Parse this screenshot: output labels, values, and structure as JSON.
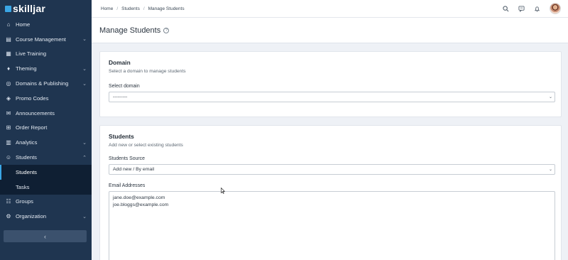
{
  "brand": {
    "name": "skilljar"
  },
  "sidebar": {
    "items": [
      {
        "label": "Home",
        "icon": "home-icon",
        "glyph": "⌂",
        "chevron": ""
      },
      {
        "label": "Course Management",
        "icon": "book-icon",
        "glyph": "▤",
        "chevron": "⌄"
      },
      {
        "label": "Live Training",
        "icon": "calendar-icon",
        "glyph": "▦",
        "chevron": ""
      },
      {
        "label": "Theming",
        "icon": "droplet-icon",
        "glyph": "♦",
        "chevron": "⌄"
      },
      {
        "label": "Domains & Publishing",
        "icon": "globe-icon",
        "glyph": "◎",
        "chevron": "⌄"
      },
      {
        "label": "Promo Codes",
        "icon": "tag-icon",
        "glyph": "◈",
        "chevron": ""
      },
      {
        "label": "Announcements",
        "icon": "mail-icon",
        "glyph": "✉",
        "chevron": ""
      },
      {
        "label": "Order Report",
        "icon": "cart-icon",
        "glyph": "⊞",
        "chevron": ""
      },
      {
        "label": "Analytics",
        "icon": "chart-icon",
        "glyph": "▥",
        "chevron": "⌄"
      },
      {
        "label": "Students",
        "icon": "user-icon",
        "glyph": "☺",
        "chevron": "⌃"
      }
    ],
    "sub_items": [
      {
        "label": "Students",
        "active": true
      },
      {
        "label": "Tasks",
        "active": false
      }
    ],
    "items_after": [
      {
        "label": "Groups",
        "icon": "users-icon",
        "glyph": "☷",
        "chevron": ""
      },
      {
        "label": "Organization",
        "icon": "gear-icon",
        "glyph": "⚙",
        "chevron": "⌄"
      }
    ],
    "collapse_glyph": "‹"
  },
  "header": {
    "breadcrumb": [
      "Home",
      "Students",
      "Manage Students"
    ],
    "separator": "/"
  },
  "page": {
    "title": "Manage Students",
    "help_glyph": "?"
  },
  "domain_card": {
    "title": "Domain",
    "subtitle": "Select a domain to manage students",
    "select_label": "Select domain",
    "select_value": "---------"
  },
  "students_card": {
    "title": "Students",
    "subtitle": "Add new or select existing students",
    "source_label": "Students Source",
    "source_value": "Add new / By email",
    "emails_label": "Email Addresses",
    "emails": [
      "jane.doe@example.com",
      "joe.bloggs@example.com"
    ]
  },
  "colors": {
    "sidebar_bg": "#1f3550",
    "sidebar_sub_bg": "#0f1f33",
    "accent": "#3aa6e5",
    "page_bg": "#eef1f6"
  }
}
